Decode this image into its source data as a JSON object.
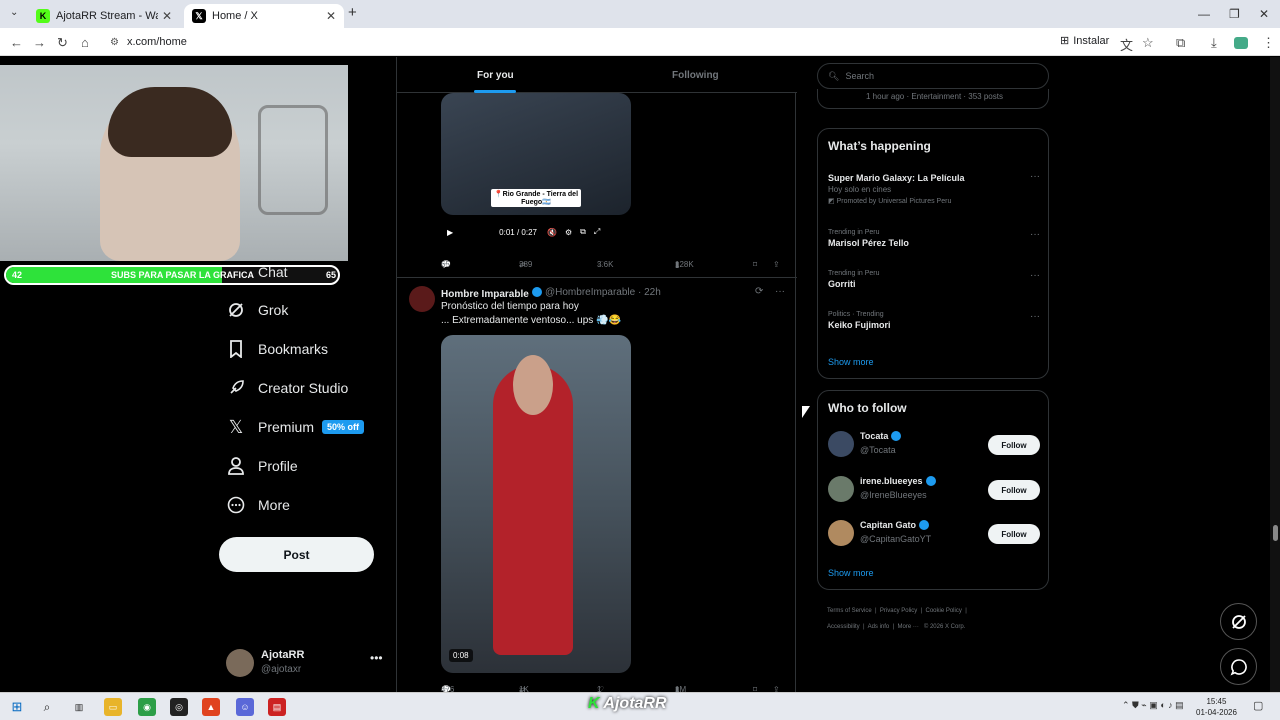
{
  "browser": {
    "tabs": [
      {
        "title": "AjotaRR Stream - Watch Live on",
        "favicon": "kick-icon",
        "color": "#53fc18"
      },
      {
        "title": "Home / X",
        "favicon": "x-logo-icon",
        "color": "#000000"
      }
    ],
    "url": "x.com/home",
    "install_label": "Instalar"
  },
  "stream_overlay": {
    "subs_left": "42",
    "subs_text": "SUBS PARA PASAR LA GRAFICA",
    "subs_right": "65",
    "subs_progress": 0.65,
    "watermark_prefix": "K",
    "watermark_name": "AjotaRR"
  },
  "sidebar": {
    "items": [
      {
        "label": "Chat",
        "icon": "chat-icon"
      },
      {
        "label": "Grok",
        "icon": "grok-icon"
      },
      {
        "label": "Bookmarks",
        "icon": "bookmark-icon"
      },
      {
        "label": "Creator Studio",
        "icon": "rocket-icon"
      },
      {
        "label": "Premium",
        "icon": "x-logo-icon",
        "badge": "50% off"
      },
      {
        "label": "Profile",
        "icon": "person-icon"
      },
      {
        "label": "More",
        "icon": "more-circle-icon"
      }
    ],
    "post_label": "Post",
    "account": {
      "name": "AjotaRR",
      "handle": "@ajotaxr"
    }
  },
  "feed": {
    "tabs": [
      "For you",
      "Following"
    ],
    "post1": {
      "video_caption": "📍Rio Grande - Tierra del Fuego🇦🇷",
      "time": "0:01 / 0:27",
      "replies": "65",
      "reposts": "389",
      "likes": "3.6K",
      "views": "128K"
    },
    "post2": {
      "name": "Hombre Imparable",
      "handle": "@HombreImparable · 22h",
      "text1": "Pronóstico del tiempo para hoy",
      "text2": "... Extremadamente ventoso... ups 💨😂",
      "duration": "0:08",
      "replies": "476",
      "reposts": "1K",
      "likes": "1",
      "views": "1M"
    }
  },
  "right": {
    "search_placeholder": "Search",
    "top_trend_meta": "1 hour ago · Entertainment · 353 posts",
    "whats_happening": {
      "title": "What’s happening",
      "trends": [
        {
          "category": "",
          "title": "Super Mario Galaxy: La Película",
          "sub": "Hoy solo en cines",
          "promo": "Promoted by Universal Pictures Peru"
        },
        {
          "category": "Trending in Peru",
          "title": "Marisol Pérez Tello"
        },
        {
          "category": "Trending in Peru",
          "title": "Gorriti"
        },
        {
          "category": "Politics · Trending",
          "title": "Keiko Fujimori"
        }
      ],
      "show_more": "Show more"
    },
    "who_to_follow": {
      "title": "Who to follow",
      "users": [
        {
          "name": "Tocata",
          "handle": "@Tocata",
          "avatar_color": "#3b4a63"
        },
        {
          "name": "irene.blueeyes",
          "handle": "@IreneBlueeyes",
          "avatar_color": "#6a7a6a"
        },
        {
          "name": "Capitan Gato",
          "handle": "@CapitanGatoYT",
          "avatar_color": "#b08a60"
        }
      ],
      "follow_label": "Follow",
      "show_more": "Show more"
    },
    "footer": {
      "links": [
        "Terms of Service",
        "Privacy Policy",
        "Cookie Policy",
        "Accessibility",
        "Ads info",
        "More ···"
      ],
      "copyright": "© 2026 X Corp."
    }
  },
  "taskbar": {
    "time": "15:45",
    "date": "01-04-2026"
  }
}
